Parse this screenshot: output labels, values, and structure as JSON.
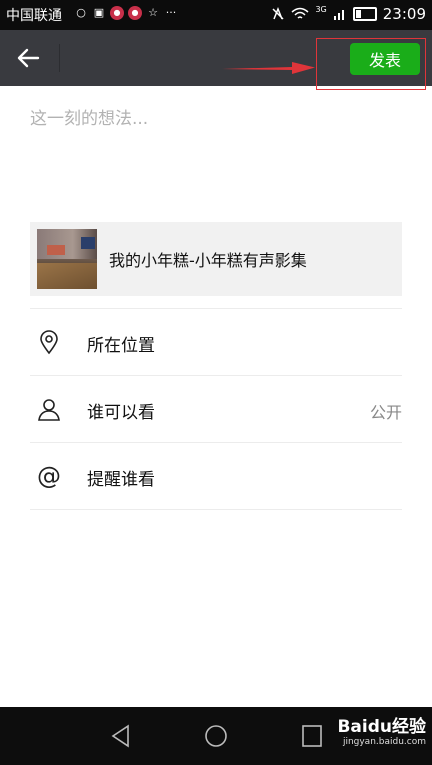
{
  "status_bar": {
    "carrier": "中国联通",
    "time": "23:09",
    "network": "3G"
  },
  "header": {
    "publish_label": "发表"
  },
  "composer": {
    "placeholder": "这一刻的想法..."
  },
  "share_card": {
    "title": "我的小年糕-小年糕有声影集"
  },
  "options": [
    {
      "label": "所在位置",
      "value": "",
      "icon": "location-pin-icon"
    },
    {
      "label": "谁可以看",
      "value": "公开",
      "icon": "person-icon"
    },
    {
      "label": "提醒谁看",
      "value": "",
      "icon": "at-icon"
    }
  ],
  "watermark": {
    "brand": "Baidu经验",
    "url": "jingyan.baidu.com"
  },
  "colors": {
    "publish_green": "#1aad19",
    "title_bar": "#393a3f",
    "highlight_red": "#e0353a"
  }
}
